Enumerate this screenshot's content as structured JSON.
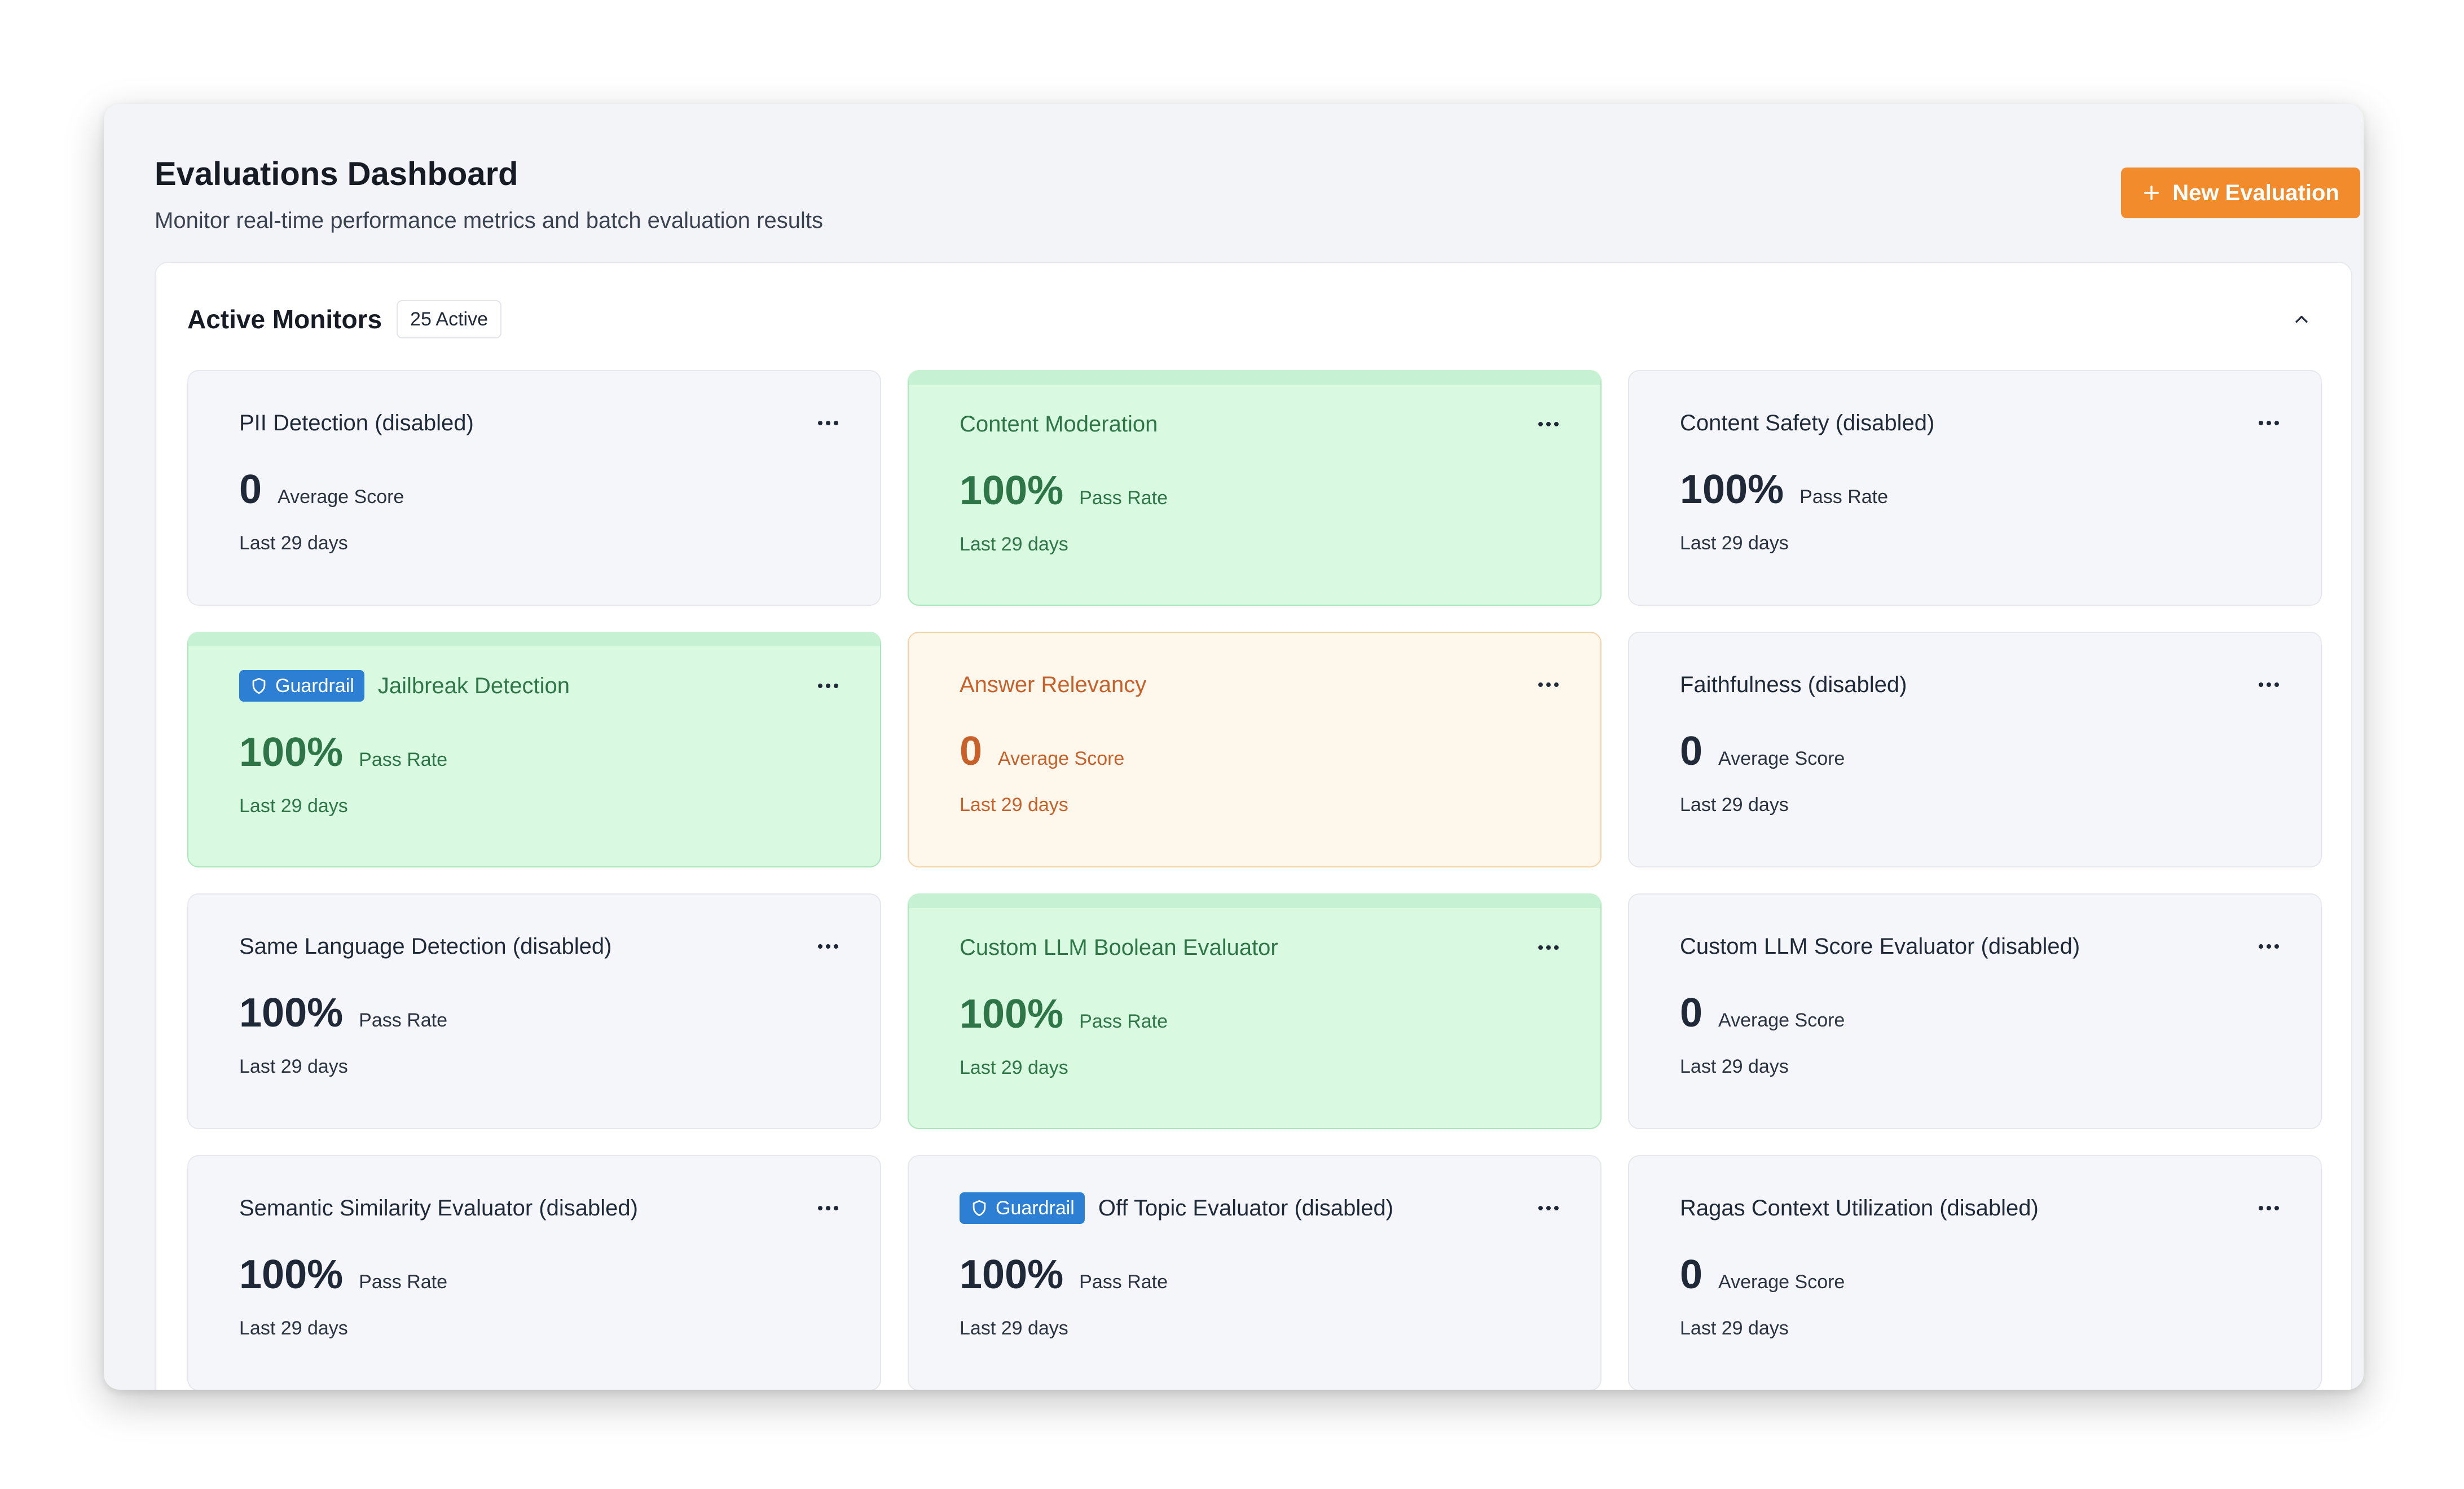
{
  "header": {
    "title": "Evaluations Dashboard",
    "subtitle": "Monitor real-time performance metrics and batch evaluation results",
    "new_button": "New Evaluation"
  },
  "panel": {
    "title": "Active Monitors",
    "count": "25 Active"
  },
  "colors": {
    "accent": "#f28b2c",
    "pass_bg": "#d9f9e1",
    "warn_bg": "#fef8ec",
    "guardrail": "#2d7fd3"
  },
  "monitors": [
    {
      "title": "PII Detection (disabled)",
      "value": "0",
      "label": "Average Score",
      "period": "Last 29 days",
      "status": "disabled"
    },
    {
      "title": "Content Moderation",
      "value": "100%",
      "label": "Pass Rate",
      "period": "Last 29 days",
      "status": "pass"
    },
    {
      "title": "Content Safety (disabled)",
      "value": "100%",
      "label": "Pass Rate",
      "period": "Last 29 days",
      "status": "disabled"
    },
    {
      "title": "Jailbreak Detection",
      "badge": "Guardrail",
      "value": "100%",
      "label": "Pass Rate",
      "period": "Last 29 days",
      "status": "pass"
    },
    {
      "title": "Answer Relevancy",
      "value": "0",
      "label": "Average Score",
      "period": "Last 29 days",
      "status": "warn"
    },
    {
      "title": "Faithfulness (disabled)",
      "value": "0",
      "label": "Average Score",
      "period": "Last 29 days",
      "status": "disabled"
    },
    {
      "title": "Same Language Detection (disabled)",
      "value": "100%",
      "label": "Pass Rate",
      "period": "Last 29 days",
      "status": "disabled"
    },
    {
      "title": "Custom LLM Boolean Evaluator",
      "value": "100%",
      "label": "Pass Rate",
      "period": "Last 29 days",
      "status": "pass"
    },
    {
      "title": "Custom LLM Score Evaluator (disabled)",
      "value": "0",
      "label": "Average Score",
      "period": "Last 29 days",
      "status": "disabled"
    },
    {
      "title": "Semantic Similarity Evaluator (disabled)",
      "value": "100%",
      "label": "Pass Rate",
      "period": "Last 29 days",
      "status": "disabled"
    },
    {
      "title": "Off Topic Evaluator (disabled)",
      "badge": "Guardrail",
      "value": "100%",
      "label": "Pass Rate",
      "period": "Last 29 days",
      "status": "disabled"
    },
    {
      "title": "Ragas Context Utilization (disabled)",
      "value": "0",
      "label": "Average Score",
      "period": "Last 29 days",
      "status": "disabled"
    }
  ]
}
